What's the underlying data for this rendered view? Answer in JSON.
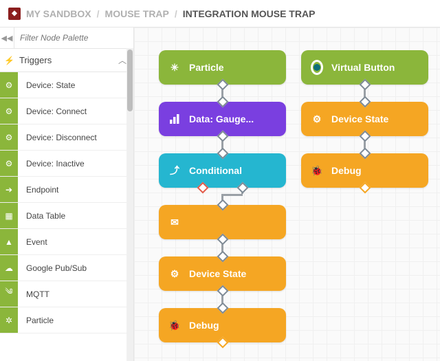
{
  "breadcrumb": {
    "root": "MY SANDBOX",
    "mid": "MOUSE TRAP",
    "current": "INTEGRATION MOUSE TRAP"
  },
  "sidebar": {
    "filter_placeholder": "Filter Node Palette",
    "category": "Triggers",
    "items": [
      {
        "label": "Device: State",
        "icon": "gear"
      },
      {
        "label": "Device: Connect",
        "icon": "gear"
      },
      {
        "label": "Device: Disconnect",
        "icon": "gear"
      },
      {
        "label": "Device: Inactive",
        "icon": "gear"
      },
      {
        "label": "Endpoint",
        "icon": "arrow"
      },
      {
        "label": "Data Table",
        "icon": "table"
      },
      {
        "label": "Event",
        "icon": "alert"
      },
      {
        "label": "Google Pub/Sub",
        "icon": "cloud"
      },
      {
        "label": "MQTT",
        "icon": "waves"
      },
      {
        "label": "Particle",
        "icon": "spark"
      }
    ]
  },
  "nodes": {
    "n1": {
      "label": "Particle",
      "color": "green",
      "icon": "spark"
    },
    "n2": {
      "label": "Data: Gauge...",
      "color": "purple",
      "icon": "bars"
    },
    "n3": {
      "label": "Conditional",
      "color": "cyan",
      "icon": "branch"
    },
    "n4": {
      "label": "",
      "color": "orange",
      "icon": "mail"
    },
    "n5": {
      "label": "Device State",
      "color": "orange",
      "icon": "gear"
    },
    "n6": {
      "label": "Debug",
      "color": "orange",
      "icon": "bug"
    },
    "n7": {
      "label": "Virtual Button",
      "color": "green",
      "icon": "ring"
    },
    "n8": {
      "label": "Device State",
      "color": "orange",
      "icon": "gear"
    },
    "n9": {
      "label": "Debug",
      "color": "orange",
      "icon": "bug"
    }
  }
}
